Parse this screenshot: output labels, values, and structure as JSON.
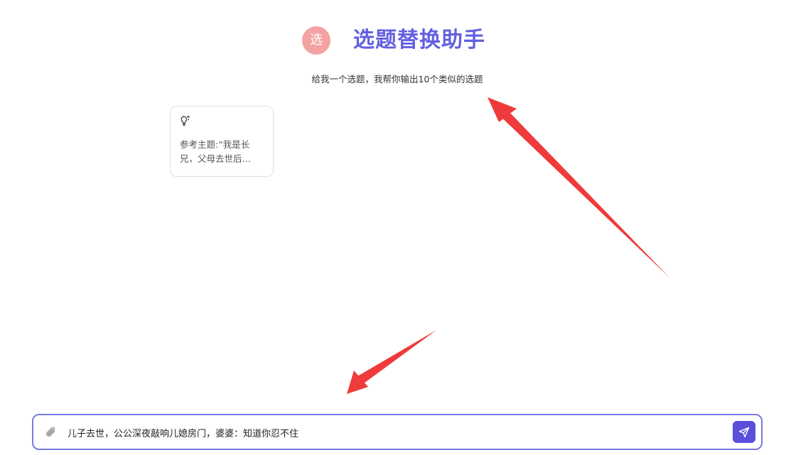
{
  "header": {
    "avatar_char": "选",
    "title": "选题替换助手",
    "subtitle": "给我一个选题，我帮你输出10个类似的选题"
  },
  "suggestions": [
    {
      "icon": "lightbulb-sparkle-icon",
      "text": "参考主题:“我是长兄，父母去世后…"
    }
  ],
  "composer": {
    "input_value": "儿子去世，公公深夜敲响儿媳房门，婆婆：知道你忍不住",
    "attach_icon": "paperclip-icon",
    "send_icon": "send-icon"
  },
  "colors": {
    "accent": "#5a4fdc",
    "title": "#6260e0",
    "avatar_bg": "#f4a3a3",
    "annotation_arrow": "#ef3b3b"
  }
}
